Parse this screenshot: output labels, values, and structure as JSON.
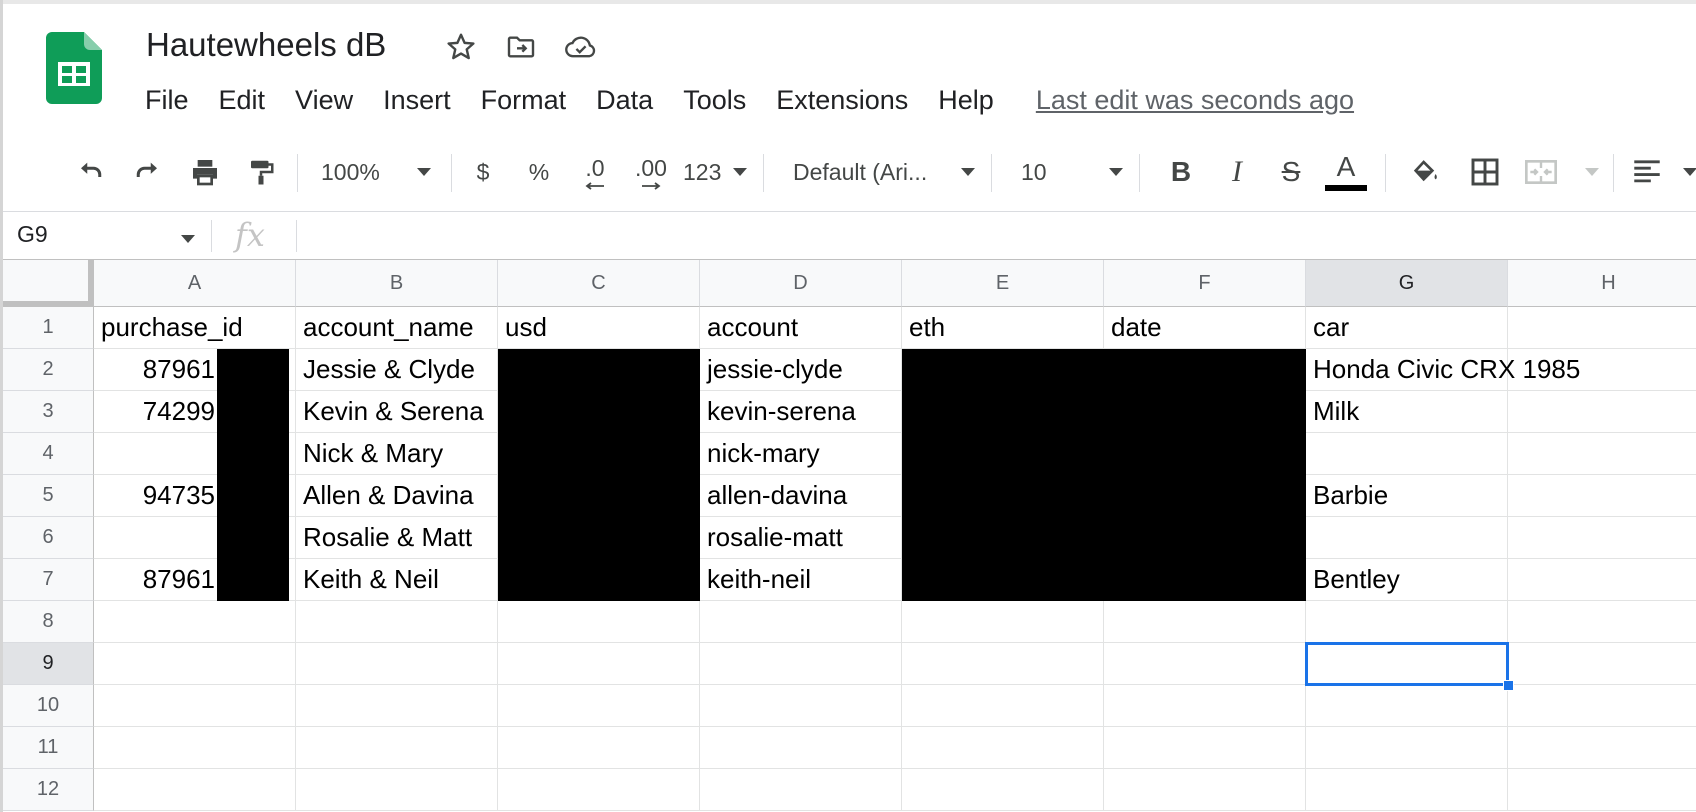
{
  "doc": {
    "title": "Hautewheels dB",
    "title_icons": [
      "star-icon",
      "move-to-folder-icon",
      "cloud-saved-icon"
    ],
    "accent_color": "#1a73e8",
    "logo_color": "#0f9d58"
  },
  "menu": {
    "items": [
      "File",
      "Edit",
      "View",
      "Insert",
      "Format",
      "Data",
      "Tools",
      "Extensions",
      "Help"
    ],
    "last_edit": "Last edit was seconds ago"
  },
  "toolbar": {
    "zoom": "100%",
    "currency": "$",
    "percent": "%",
    "decrease_decimals": ".0",
    "increase_decimals": ".00",
    "more_formats": "123",
    "font": "Default (Ari...",
    "font_size": "10",
    "bold": "B",
    "italic": "I",
    "strikethrough": "S",
    "text_color": "A",
    "icons": [
      "undo-icon",
      "redo-icon",
      "print-icon",
      "paint-format-icon",
      "fill-color-icon",
      "borders-icon",
      "merge-cells-icon",
      "align-icon"
    ]
  },
  "formula_bar": {
    "name_box": "G9",
    "fx": "fx",
    "content": ""
  },
  "sheet": {
    "columns": [
      "A",
      "B",
      "C",
      "D",
      "E",
      "F",
      "G",
      "H"
    ],
    "rows": [
      "1",
      "2",
      "3",
      "4",
      "5",
      "6",
      "7",
      "8",
      "9",
      "10",
      "11",
      "12"
    ],
    "selected_cell": "G9",
    "header_row": [
      "purchase_id",
      "account_name",
      "usd",
      "account",
      "eth",
      "date",
      "car",
      ""
    ],
    "data": [
      [
        "87961",
        "Jessie & Clyde",
        "",
        "jessie-clyde",
        "",
        "",
        "Honda Civic CRX 1985",
        ""
      ],
      [
        "74299",
        "Kevin & Serena",
        "",
        "kevin-serena",
        "",
        "",
        "Milk",
        ""
      ],
      [
        "",
        "Nick & Mary",
        "",
        "nick-mary",
        "",
        "",
        "",
        ""
      ],
      [
        "94735",
        "Allen & Davina",
        "",
        "allen-davina",
        "",
        "",
        "Barbie",
        ""
      ],
      [
        "",
        "Rosalie & Matt",
        "",
        "rosalie-matt",
        "",
        "",
        "",
        ""
      ],
      [
        "87961",
        "Keith & Neil",
        "",
        "keith-neil",
        "",
        "",
        "Bentley",
        ""
      ]
    ]
  }
}
